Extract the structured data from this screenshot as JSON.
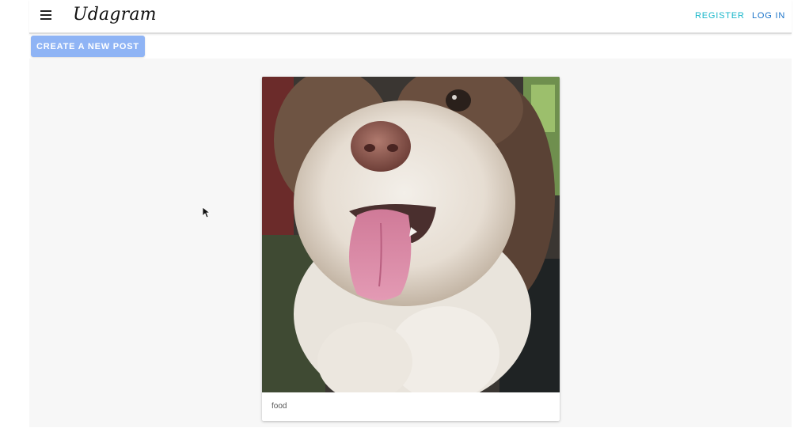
{
  "header": {
    "brand": "Udagram",
    "menu_icon": "hamburger-menu-icon",
    "register_label": "REGISTER",
    "login_label": "LOG IN",
    "register_color": "#17b6c9",
    "login_color": "#1a73c9"
  },
  "actions": {
    "create_post_label": "CREATE A NEW POST",
    "button_color": "#8fb4f5"
  },
  "feed": {
    "posts": [
      {
        "image_subject": "fluffy brown and white dog with tongue out",
        "caption": "food"
      }
    ]
  }
}
